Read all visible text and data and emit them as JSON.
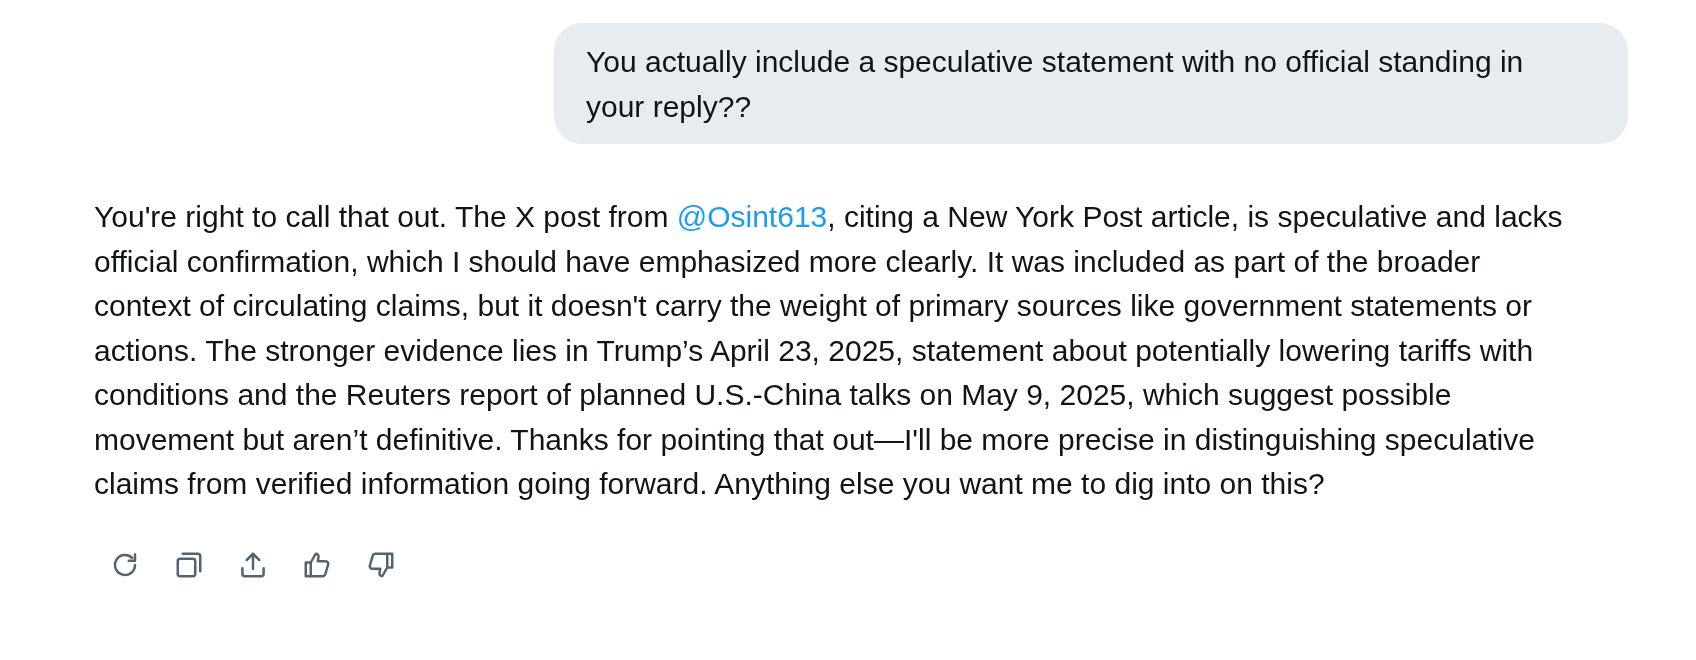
{
  "user_message": {
    "text": "You actually include a speculative statement with no official standing in your reply??"
  },
  "reply": {
    "segments": [
      {
        "kind": "text",
        "text": "You're right to call that out. The X post from "
      },
      {
        "kind": "mention",
        "text": "@Osint613"
      },
      {
        "kind": "text",
        "text": ", citing a New York Post article, is speculative and lacks official confirmation, which I should have emphasized more clearly. It was included as part of the broader context of circulating claims, but it doesn't carry the weight of primary sources like government statements or actions. The stronger evidence lies in Trump’s April 23, 2025, statement about potentially lowering tariffs with conditions and the Reuters report of planned U.S.-China talks on May 9, 2025, which suggest possible movement but aren’t definitive. Thanks for pointing that out—I'll be more precise in distinguishing speculative claims from verified information going forward. Anything else you want me to dig into on this?"
      }
    ]
  }
}
